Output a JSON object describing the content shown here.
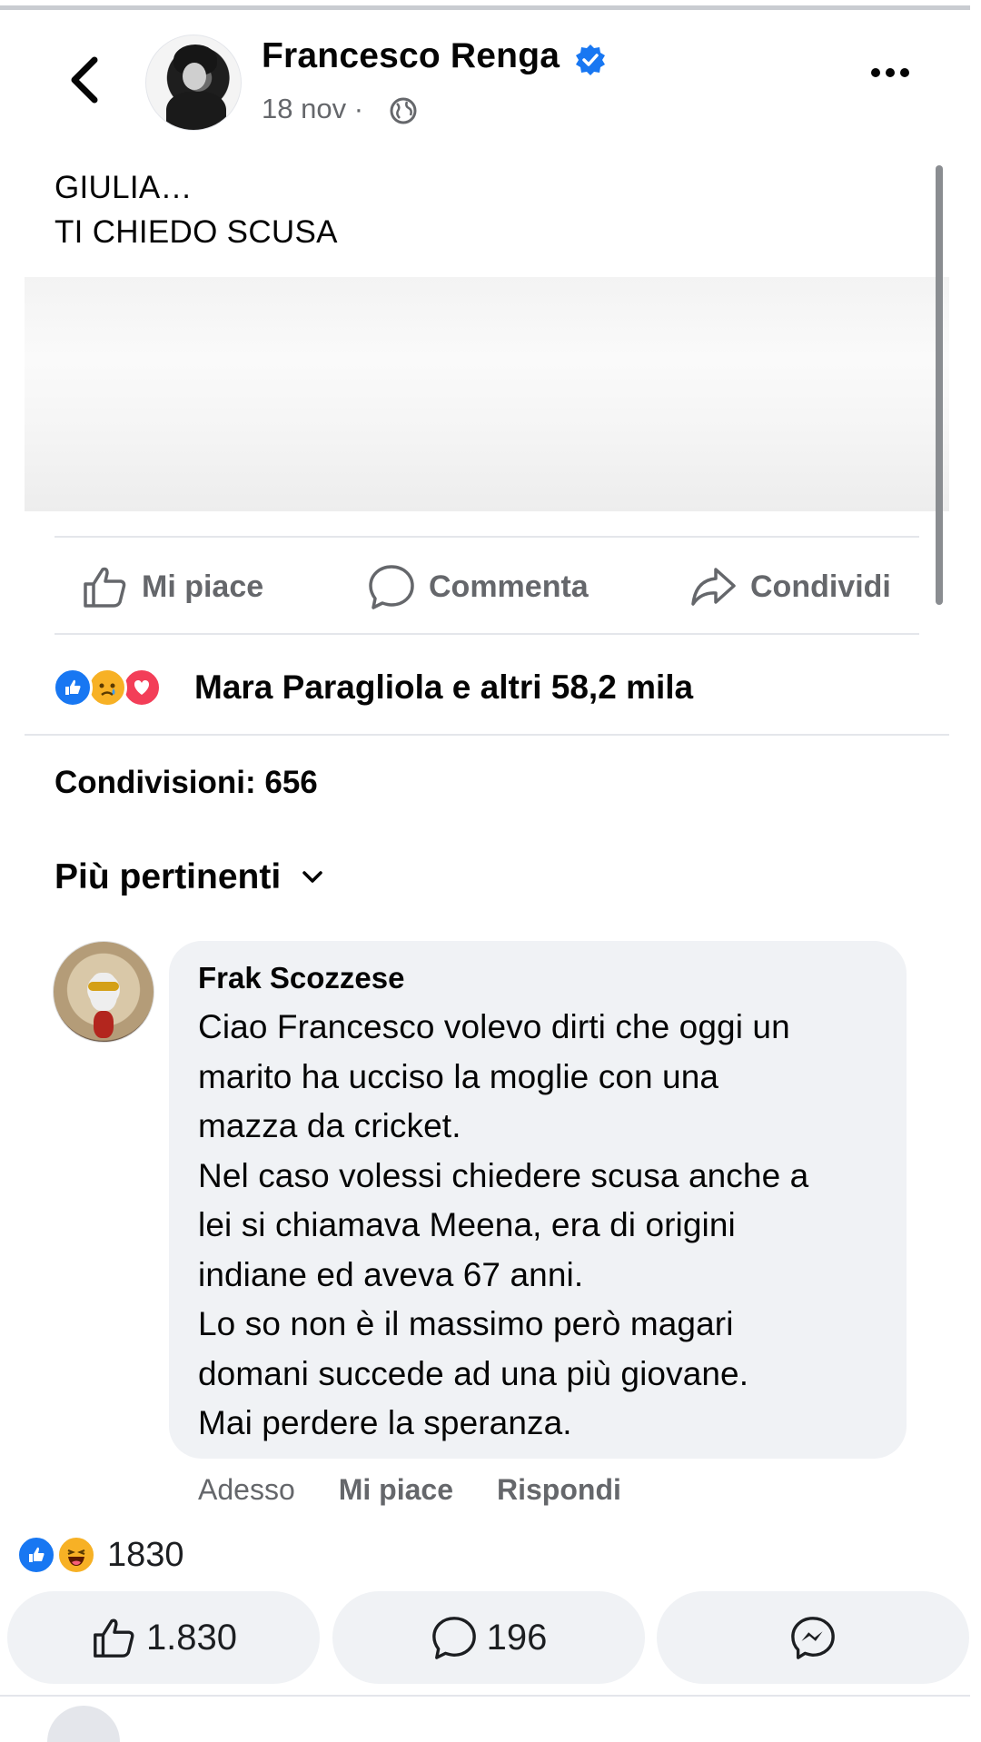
{
  "header": {
    "author": "Francesco Renga",
    "date": "18 nov",
    "separator": "·"
  },
  "post": {
    "text": "GIULIA…\nTI CHIEDO SCUSA"
  },
  "actions": {
    "like": "Mi piace",
    "comment": "Commenta",
    "share": "Condividi"
  },
  "reactions": {
    "text": "Mara Paragliola e altri 58,2 mila",
    "icons": [
      "like-icon",
      "sad-icon",
      "love-icon"
    ]
  },
  "shares": "Condivisioni: 656",
  "sort": {
    "label": "Più pertinenti"
  },
  "comment": {
    "author": "Frak Scozzese",
    "text": "Ciao Francesco volevo dirti che oggi un\nmarito ha ucciso la moglie con una\nmazza da cricket.\nNel caso volessi chiedere scusa anche a\nlei si chiamava Meena, era di origini\nindiane ed aveva 67 anni.\nLo so non è il massimo però magari\ndomani succede ad una più giovane.\nMai perdere la speranza.",
    "time": "Adesso",
    "like": "Mi piace",
    "reply": "Rispondi"
  },
  "comment_reactions": {
    "count": "1830",
    "icons": [
      "like-icon",
      "haha-icon"
    ]
  },
  "bottom_bar": {
    "likes": "1.830",
    "comments": "196",
    "messenger": "messenger-icon"
  },
  "colors": {
    "brand_blue": "#1877f2",
    "love_red": "#f33e58",
    "reaction_yellow": "#f7b125",
    "secondary_text": "#65676b",
    "bubble_bg": "#f0f2f5"
  }
}
